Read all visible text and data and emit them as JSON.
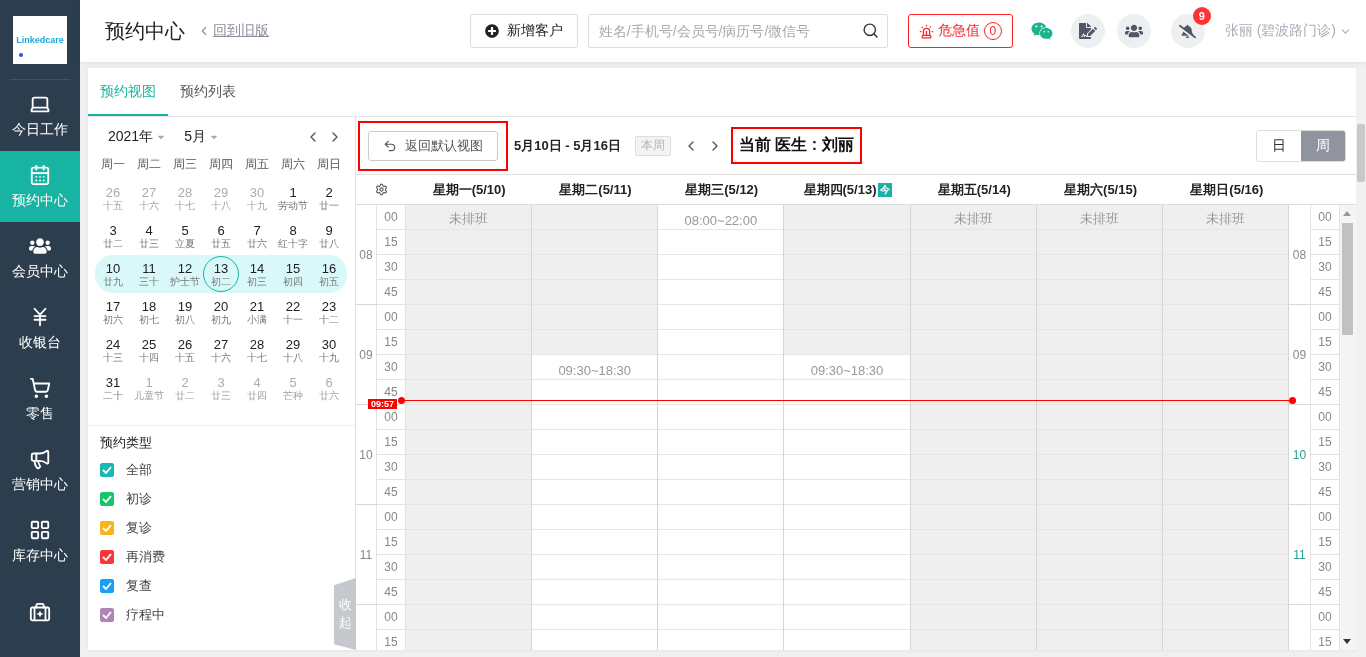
{
  "sidebar": {
    "logo_text": "Linkedcare",
    "items": [
      {
        "kind": "laptop",
        "label": "今日工作",
        "selected": false
      },
      {
        "kind": "calendar",
        "label": "预约中心",
        "selected": true
      },
      {
        "kind": "users",
        "label": "会员中心",
        "selected": false
      },
      {
        "kind": "yen",
        "label": "收银台",
        "selected": false
      },
      {
        "kind": "cart",
        "label": "零售",
        "selected": false
      },
      {
        "kind": "megaphone",
        "label": "营销中心",
        "selected": false
      },
      {
        "kind": "grid",
        "label": "库存中心",
        "selected": false
      },
      {
        "kind": "medkit",
        "selected": false
      }
    ]
  },
  "header": {
    "title": "预约中心",
    "back_link": "回到旧版",
    "add_button": "新增客户",
    "search": {
      "placeholder": "姓名/手机号/会员号/病历号/微信号"
    },
    "alert": {
      "label": "危急值",
      "count": "0"
    },
    "notification_count": "9",
    "user": "张丽 (碧波路门诊)"
  },
  "tabs": [
    {
      "label": "预约视图",
      "selected": true
    },
    {
      "label": "预约列表",
      "selected": false
    }
  ],
  "mini_calendar": {
    "year": "2021年",
    "month": "5月",
    "weekdays": [
      "周一",
      "周二",
      "周三",
      "周四",
      "周五",
      "周六",
      "周日"
    ],
    "weeks": [
      {
        "selected": false,
        "days": [
          {
            "d": "26",
            "lunar": "十五",
            "muted": true,
            "selected": false
          },
          {
            "d": "27",
            "lunar": "十六",
            "muted": true,
            "selected": false
          },
          {
            "d": "28",
            "lunar": "十七",
            "muted": true,
            "selected": false
          },
          {
            "d": "29",
            "lunar": "十八",
            "muted": true,
            "selected": false
          },
          {
            "d": "30",
            "lunar": "十九",
            "muted": true,
            "selected": false
          },
          {
            "d": "1",
            "lunar": "劳动节",
            "muted": false,
            "selected": false
          },
          {
            "d": "2",
            "lunar": "廿一",
            "muted": false,
            "selected": false
          }
        ]
      },
      {
        "selected": false,
        "days": [
          {
            "d": "3",
            "lunar": "廿二",
            "muted": false,
            "selected": false
          },
          {
            "d": "4",
            "lunar": "廿三",
            "muted": false,
            "selected": false
          },
          {
            "d": "5",
            "lunar": "立夏",
            "muted": false,
            "selected": false
          },
          {
            "d": "6",
            "lunar": "廿五",
            "muted": false,
            "selected": false
          },
          {
            "d": "7",
            "lunar": "廿六",
            "muted": false,
            "selected": false
          },
          {
            "d": "8",
            "lunar": "红十字",
            "muted": false,
            "selected": false
          },
          {
            "d": "9",
            "lunar": "廿八",
            "muted": false,
            "selected": false
          }
        ]
      },
      {
        "selected": true,
        "days": [
          {
            "d": "10",
            "lunar": "廿九",
            "muted": false,
            "selected": false
          },
          {
            "d": "11",
            "lunar": "三十",
            "muted": false,
            "selected": false
          },
          {
            "d": "12",
            "lunar": "护士节",
            "muted": false,
            "selected": false
          },
          {
            "d": "13",
            "lunar": "初二",
            "muted": false,
            "selected": true
          },
          {
            "d": "14",
            "lunar": "初三",
            "muted": false,
            "selected": false
          },
          {
            "d": "15",
            "lunar": "初四",
            "muted": false,
            "selected": false
          },
          {
            "d": "16",
            "lunar": "初五",
            "muted": false,
            "selected": false
          }
        ]
      },
      {
        "selected": false,
        "days": [
          {
            "d": "17",
            "lunar": "初六",
            "muted": false,
            "selected": false
          },
          {
            "d": "18",
            "lunar": "初七",
            "muted": false,
            "selected": false
          },
          {
            "d": "19",
            "lunar": "初八",
            "muted": false,
            "selected": false
          },
          {
            "d": "20",
            "lunar": "初九",
            "muted": false,
            "selected": false
          },
          {
            "d": "21",
            "lunar": "小满",
            "muted": false,
            "selected": false
          },
          {
            "d": "22",
            "lunar": "十一",
            "muted": false,
            "selected": false
          },
          {
            "d": "23",
            "lunar": "十二",
            "muted": false,
            "selected": false
          }
        ]
      },
      {
        "selected": false,
        "days": [
          {
            "d": "24",
            "lunar": "十三",
            "muted": false,
            "selected": false
          },
          {
            "d": "25",
            "lunar": "十四",
            "muted": false,
            "selected": false
          },
          {
            "d": "26",
            "lunar": "十五",
            "muted": false,
            "selected": false
          },
          {
            "d": "27",
            "lunar": "十六",
            "muted": false,
            "selected": false
          },
          {
            "d": "28",
            "lunar": "十七",
            "muted": false,
            "selected": false
          },
          {
            "d": "29",
            "lunar": "十八",
            "muted": false,
            "selected": false
          },
          {
            "d": "30",
            "lunar": "十九",
            "muted": false,
            "selected": false
          }
        ]
      },
      {
        "selected": false,
        "days": [
          {
            "d": "31",
            "lunar": "二十",
            "muted": false,
            "selected": false
          },
          {
            "d": "1",
            "lunar": "儿童节",
            "muted": true,
            "selected": false
          },
          {
            "d": "2",
            "lunar": "廿二",
            "muted": true,
            "selected": false
          },
          {
            "d": "3",
            "lunar": "廿三",
            "muted": true,
            "selected": false
          },
          {
            "d": "4",
            "lunar": "廿四",
            "muted": true,
            "selected": false
          },
          {
            "d": "5",
            "lunar": "芒种",
            "muted": true,
            "selected": false
          },
          {
            "d": "6",
            "lunar": "廿六",
            "muted": true,
            "selected": false
          }
        ]
      }
    ]
  },
  "appointment_types": {
    "title": "预约类型",
    "items": [
      {
        "label": "全部",
        "checked": true,
        "color": "#1bb8b3"
      },
      {
        "label": "初诊",
        "checked": true,
        "color": "#17c66a"
      },
      {
        "label": "复诊",
        "checked": true,
        "color": "#fbb31c"
      },
      {
        "label": "再消费",
        "checked": true,
        "color": "#f6383b"
      },
      {
        "label": "复查",
        "checked": true,
        "color": "#1a9ff6"
      },
      {
        "label": "疗程中",
        "checked": true,
        "color": "#b283b9"
      }
    ]
  },
  "collapse_tab": "收起",
  "toolbar": {
    "return_button": {
      "label": "返回默认视图",
      "highlighted": true
    },
    "date_range": "5月10日 - 5月16日",
    "this_week": {
      "label": "本周",
      "disabled": true
    },
    "doctor": {
      "label": "当前 医生 : 刘丽",
      "highlighted": true
    },
    "views": [
      {
        "label": "日",
        "selected": false
      },
      {
        "label": "周",
        "selected": true
      }
    ]
  },
  "schedule": {
    "days": [
      {
        "header": "星期一(5/10)",
        "kind": "off",
        "label": "未排班"
      },
      {
        "header": "星期二(5/11)",
        "kind": "shift",
        "label": "09:30~18:30"
      },
      {
        "header": "星期三(5/12)",
        "kind": "shift",
        "label": "08:00~22:00"
      },
      {
        "header": "星期四(5/13)",
        "kind": "shift",
        "label": "09:30~18:30",
        "today_mark": "今"
      },
      {
        "header": "星期五(5/14)",
        "kind": "off",
        "label": "未排班"
      },
      {
        "header": "星期六(5/15)",
        "kind": "off",
        "label": "未排班"
      },
      {
        "header": "星期日(5/16)",
        "kind": "off",
        "label": "未排班"
      }
    ],
    "time_axis_left": [
      {
        "hour": "08",
        "minutes": [
          "00",
          "15",
          "30",
          "45"
        ]
      },
      {
        "hour": "09",
        "minutes": [
          "00",
          "15",
          "30",
          "45"
        ]
      },
      {
        "hour": "10",
        "minutes": [
          "00",
          "15",
          "30",
          "45"
        ]
      },
      {
        "hour": "11",
        "minutes": [
          "00",
          "15",
          "30",
          "45"
        ]
      },
      {
        "minutes": [
          "00",
          "15"
        ]
      }
    ],
    "time_axis_right": [
      {
        "hour": "08",
        "minutes": [
          "00",
          "15",
          "30",
          "45"
        ]
      },
      {
        "hour": "09",
        "minutes": [
          "00",
          "15",
          "30",
          "45"
        ]
      },
      {
        "hour": "10",
        "minutes": [
          "00",
          "15",
          "30",
          "45"
        ]
      },
      {
        "hour": "11",
        "minutes": [
          "00",
          "15",
          "30",
          "45"
        ]
      },
      {
        "minutes": [
          "00",
          "15"
        ]
      }
    ],
    "now": "09:57"
  }
}
